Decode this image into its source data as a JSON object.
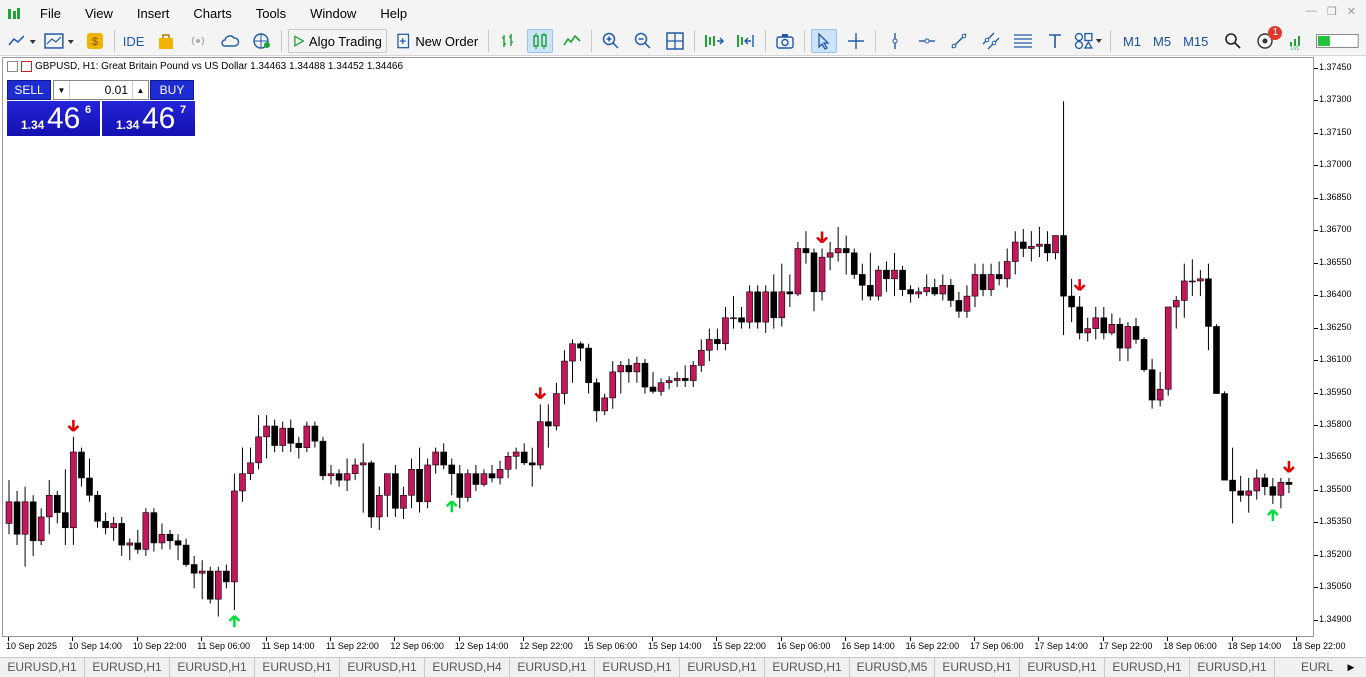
{
  "menu": [
    "File",
    "Edit",
    "View",
    "Insert",
    "Charts",
    "Tools",
    "Window",
    "Help"
  ],
  "toolbar": {
    "ide_label": "IDE",
    "algo_label": "Algo Trading",
    "neworder_label": "New Order",
    "timeframes": [
      "M1",
      "M5",
      "M15"
    ],
    "notification_count": "1"
  },
  "chart": {
    "symbol_line": "GBPUSD, H1:  Great Britain Pound vs US Dollar  1.34463 1.34488 1.34452 1.34466",
    "sell_label": "SELL",
    "buy_label": "BUY",
    "volume": "0.01",
    "sell_prefix": "1.34",
    "sell_big": "46",
    "sell_sup": "6",
    "buy_prefix": "1.34",
    "buy_big": "46",
    "buy_sup": "7",
    "up_color": "#c2185b",
    "down_color": "#000000",
    "arrow_up_color": "#00e03a",
    "arrow_down_color": "#e00000"
  },
  "price_labels": [
    "1.37450",
    "1.37300",
    "1.37150",
    "1.37000",
    "1.36850",
    "1.36700",
    "1.36550",
    "1.36400",
    "1.36250",
    "1.36100",
    "1.35950",
    "1.35800",
    "1.35650",
    "1.35500",
    "1.35350",
    "1.35200",
    "1.35050",
    "1.34900"
  ],
  "time_labels": [
    "10 Sep 2025",
    "10 Sep 14:00",
    "10 Sep 22:00",
    "11 Sep 06:00",
    "11 Sep 14:00",
    "11 Sep 22:00",
    "12 Sep 06:00",
    "12 Sep 14:00",
    "12 Sep 22:00",
    "15 Sep 06:00",
    "15 Sep 14:00",
    "15 Sep 22:00",
    "16 Sep 06:00",
    "16 Sep 14:00",
    "16 Sep 22:00",
    "17 Sep 06:00",
    "17 Sep 14:00",
    "17 Sep 22:00",
    "18 Sep 06:00",
    "18 Sep 14:00",
    "18 Sep 22:00"
  ],
  "tabs": [
    "EURUSD,H1",
    "EURUSD,H1",
    "EURUSD,H1",
    "EURUSD,H1",
    "EURUSD,H1",
    "EURUSD,H4",
    "EURUSD,H1",
    "EURUSD,H1",
    "EURUSD,H1",
    "EURUSD,H1",
    "EURUSD,M5",
    "EURUSD,H1",
    "EURUSD,H1",
    "EURUSD,H1",
    "EURUSD,H1",
    "EURL"
  ],
  "chart_data": {
    "type": "candlestick",
    "symbol": "GBPUSD",
    "timeframe": "H1",
    "ylim": [
      1.3483,
      1.375
    ],
    "candles": [
      [
        1.3535,
        1.3555,
        1.353,
        1.3545
      ],
      [
        1.3545,
        1.355,
        1.3525,
        1.353
      ],
      [
        1.353,
        1.3552,
        1.3515,
        1.3545
      ],
      [
        1.3545,
        1.3548,
        1.352,
        1.3527
      ],
      [
        1.3527,
        1.3542,
        1.3525,
        1.3538
      ],
      [
        1.3538,
        1.3555,
        1.353,
        1.3548
      ],
      [
        1.3548,
        1.355,
        1.3535,
        1.354
      ],
      [
        1.354,
        1.356,
        1.3525,
        1.3533
      ],
      [
        1.3533,
        1.3575,
        1.3525,
        1.3568
      ],
      [
        1.3568,
        1.357,
        1.3552,
        1.3556
      ],
      [
        1.3556,
        1.3565,
        1.3545,
        1.3548
      ],
      [
        1.3548,
        1.355,
        1.3533,
        1.3536
      ],
      [
        1.3536,
        1.354,
        1.353,
        1.3533
      ],
      [
        1.3533,
        1.3538,
        1.3527,
        1.3535
      ],
      [
        1.3535,
        1.3538,
        1.352,
        1.3525
      ],
      [
        1.3525,
        1.3528,
        1.3518,
        1.3526
      ],
      [
        1.3526,
        1.3532,
        1.3521,
        1.3523
      ],
      [
        1.3523,
        1.3542,
        1.352,
        1.354
      ],
      [
        1.354,
        1.3542,
        1.3522,
        1.3526
      ],
      [
        1.3526,
        1.3535,
        1.3523,
        1.353
      ],
      [
        1.353,
        1.3532,
        1.3523,
        1.3527
      ],
      [
        1.3527,
        1.353,
        1.3518,
        1.3525
      ],
      [
        1.3525,
        1.3528,
        1.3515,
        1.3516
      ],
      [
        1.3516,
        1.352,
        1.3505,
        1.3512
      ],
      [
        1.3512,
        1.3518,
        1.35,
        1.3513
      ],
      [
        1.3513,
        1.3515,
        1.3498,
        1.35
      ],
      [
        1.35,
        1.3515,
        1.3492,
        1.3513
      ],
      [
        1.3513,
        1.3516,
        1.3505,
        1.3508
      ],
      [
        1.3508,
        1.3558,
        1.3495,
        1.355
      ],
      [
        1.355,
        1.357,
        1.3545,
        1.3558
      ],
      [
        1.3558,
        1.357,
        1.3555,
        1.3563
      ],
      [
        1.3563,
        1.3585,
        1.356,
        1.3575
      ],
      [
        1.3575,
        1.3585,
        1.3565,
        1.358
      ],
      [
        1.358,
        1.3583,
        1.3568,
        1.3571
      ],
      [
        1.3571,
        1.3582,
        1.3568,
        1.3579
      ],
      [
        1.3579,
        1.3583,
        1.3568,
        1.3572
      ],
      [
        1.3572,
        1.3575,
        1.3565,
        1.357
      ],
      [
        1.357,
        1.3582,
        1.3568,
        1.358
      ],
      [
        1.358,
        1.3582,
        1.357,
        1.3573
      ],
      [
        1.3573,
        1.3575,
        1.3555,
        1.3557
      ],
      [
        1.3557,
        1.3562,
        1.3553,
        1.3558
      ],
      [
        1.3558,
        1.356,
        1.3552,
        1.3555
      ],
      [
        1.3555,
        1.3565,
        1.355,
        1.3558
      ],
      [
        1.3558,
        1.3565,
        1.3555,
        1.3562
      ],
      [
        1.3562,
        1.3572,
        1.354,
        1.3563
      ],
      [
        1.3563,
        1.3564,
        1.3533,
        1.3538
      ],
      [
        1.3538,
        1.3552,
        1.3532,
        1.3548
      ],
      [
        1.3548,
        1.3557,
        1.3538,
        1.3558
      ],
      [
        1.3558,
        1.3562,
        1.3538,
        1.3542
      ],
      [
        1.3542,
        1.3552,
        1.3537,
        1.3548
      ],
      [
        1.3548,
        1.3565,
        1.3542,
        1.356
      ],
      [
        1.356,
        1.357,
        1.354,
        1.3545
      ],
      [
        1.3545,
        1.3565,
        1.3542,
        1.3562
      ],
      [
        1.3562,
        1.357,
        1.3558,
        1.3568
      ],
      [
        1.3568,
        1.3572,
        1.356,
        1.3562
      ],
      [
        1.3562,
        1.3565,
        1.3548,
        1.3558
      ],
      [
        1.3558,
        1.3562,
        1.3542,
        1.3547
      ],
      [
        1.3547,
        1.356,
        1.3545,
        1.3558
      ],
      [
        1.3558,
        1.3562,
        1.355,
        1.3553
      ],
      [
        1.3553,
        1.356,
        1.3552,
        1.3558
      ],
      [
        1.3558,
        1.3562,
        1.3554,
        1.3556
      ],
      [
        1.3556,
        1.3564,
        1.3553,
        1.356
      ],
      [
        1.356,
        1.3568,
        1.3556,
        1.3566
      ],
      [
        1.3566,
        1.357,
        1.356,
        1.3568
      ],
      [
        1.3568,
        1.3572,
        1.3562,
        1.3563
      ],
      [
        1.3563,
        1.357,
        1.3552,
        1.3562
      ],
      [
        1.3562,
        1.359,
        1.356,
        1.3582
      ],
      [
        1.3582,
        1.359,
        1.357,
        1.358
      ],
      [
        1.358,
        1.36,
        1.3578,
        1.3595
      ],
      [
        1.3595,
        1.3615,
        1.359,
        1.361
      ],
      [
        1.361,
        1.362,
        1.36,
        1.3618
      ],
      [
        1.3618,
        1.3619,
        1.361,
        1.3616
      ],
      [
        1.3616,
        1.3618,
        1.3595,
        1.36
      ],
      [
        1.36,
        1.3602,
        1.3582,
        1.3587
      ],
      [
        1.3587,
        1.3595,
        1.3585,
        1.3593
      ],
      [
        1.3593,
        1.361,
        1.3588,
        1.3605
      ],
      [
        1.3605,
        1.361,
        1.3595,
        1.3608
      ],
      [
        1.3608,
        1.3611,
        1.36,
        1.3605
      ],
      [
        1.3605,
        1.3612,
        1.36,
        1.3609
      ],
      [
        1.3609,
        1.3611,
        1.3595,
        1.3598
      ],
      [
        1.3598,
        1.3605,
        1.3595,
        1.3596
      ],
      [
        1.3596,
        1.3602,
        1.3594,
        1.36
      ],
      [
        1.36,
        1.3603,
        1.3597,
        1.3601
      ],
      [
        1.3601,
        1.3605,
        1.3598,
        1.3602
      ],
      [
        1.3602,
        1.3608,
        1.3598,
        1.3601
      ],
      [
        1.3601,
        1.361,
        1.3598,
        1.3608
      ],
      [
        1.3608,
        1.362,
        1.3605,
        1.3615
      ],
      [
        1.3615,
        1.3625,
        1.361,
        1.362
      ],
      [
        1.362,
        1.3625,
        1.3615,
        1.3618
      ],
      [
        1.3618,
        1.3635,
        1.3615,
        1.363
      ],
      [
        1.363,
        1.364,
        1.3625,
        1.363
      ],
      [
        1.363,
        1.3635,
        1.3625,
        1.3628
      ],
      [
        1.3628,
        1.3645,
        1.3625,
        1.3642
      ],
      [
        1.3642,
        1.3645,
        1.3625,
        1.3628
      ],
      [
        1.3628,
        1.3645,
        1.3623,
        1.3642
      ],
      [
        1.3642,
        1.365,
        1.3625,
        1.363
      ],
      [
        1.363,
        1.3655,
        1.3626,
        1.3642
      ],
      [
        1.3642,
        1.365,
        1.3635,
        1.3641
      ],
      [
        1.3641,
        1.3665,
        1.364,
        1.3662
      ],
      [
        1.3662,
        1.367,
        1.3655,
        1.366
      ],
      [
        1.366,
        1.3662,
        1.3633,
        1.3642
      ],
      [
        1.3642,
        1.3662,
        1.3638,
        1.3658
      ],
      [
        1.3658,
        1.3665,
        1.3652,
        1.366
      ],
      [
        1.366,
        1.3672,
        1.3656,
        1.3662
      ],
      [
        1.3662,
        1.3668,
        1.365,
        1.366
      ],
      [
        1.366,
        1.3662,
        1.3648,
        1.365
      ],
      [
        1.365,
        1.3655,
        1.3638,
        1.3645
      ],
      [
        1.3645,
        1.366,
        1.3638,
        1.364
      ],
      [
        1.364,
        1.3654,
        1.3638,
        1.3652
      ],
      [
        1.3652,
        1.3656,
        1.3642,
        1.3648
      ],
      [
        1.3648,
        1.366,
        1.364,
        1.3652
      ],
      [
        1.3652,
        1.3654,
        1.364,
        1.3643
      ],
      [
        1.3643,
        1.3645,
        1.3637,
        1.3641
      ],
      [
        1.3641,
        1.3644,
        1.3639,
        1.3642
      ],
      [
        1.3642,
        1.365,
        1.364,
        1.3644
      ],
      [
        1.3644,
        1.3648,
        1.364,
        1.3641
      ],
      [
        1.3641,
        1.365,
        1.3638,
        1.3645
      ],
      [
        1.3645,
        1.3648,
        1.3635,
        1.3638
      ],
      [
        1.3638,
        1.3642,
        1.363,
        1.3633
      ],
      [
        1.3633,
        1.3645,
        1.363,
        1.364
      ],
      [
        1.364,
        1.3655,
        1.3635,
        1.365
      ],
      [
        1.365,
        1.3655,
        1.364,
        1.3643
      ],
      [
        1.3643,
        1.3655,
        1.364,
        1.365
      ],
      [
        1.365,
        1.3656,
        1.3645,
        1.3648
      ],
      [
        1.3648,
        1.3662,
        1.3644,
        1.3656
      ],
      [
        1.3656,
        1.367,
        1.365,
        1.3665
      ],
      [
        1.3665,
        1.3671,
        1.3658,
        1.3662
      ],
      [
        1.3662,
        1.367,
        1.3656,
        1.3663
      ],
      [
        1.3663,
        1.3672,
        1.3658,
        1.3664
      ],
      [
        1.3664,
        1.367,
        1.3656,
        1.366
      ],
      [
        1.366,
        1.3668,
        1.3657,
        1.3668
      ],
      [
        1.3668,
        1.373,
        1.3622,
        1.364
      ],
      [
        1.364,
        1.3648,
        1.3628,
        1.3635
      ],
      [
        1.3635,
        1.364,
        1.362,
        1.3623
      ],
      [
        1.3623,
        1.363,
        1.3619,
        1.3625
      ],
      [
        1.3625,
        1.3635,
        1.362,
        1.363
      ],
      [
        1.363,
        1.3635,
        1.362,
        1.3623
      ],
      [
        1.3623,
        1.3632,
        1.3622,
        1.3627
      ],
      [
        1.3627,
        1.363,
        1.361,
        1.3616
      ],
      [
        1.3616,
        1.3628,
        1.361,
        1.3626
      ],
      [
        1.3626,
        1.363,
        1.3618,
        1.362
      ],
      [
        1.362,
        1.3621,
        1.3605,
        1.3606
      ],
      [
        1.3606,
        1.3611,
        1.3588,
        1.3592
      ],
      [
        1.3592,
        1.3605,
        1.3589,
        1.3597
      ],
      [
        1.3597,
        1.3632,
        1.3594,
        1.3635
      ],
      [
        1.3635,
        1.364,
        1.3625,
        1.3638
      ],
      [
        1.3638,
        1.3655,
        1.363,
        1.3647
      ],
      [
        1.3647,
        1.3657,
        1.364,
        1.3647
      ],
      [
        1.3647,
        1.3652,
        1.364,
        1.3648
      ],
      [
        1.3648,
        1.3655,
        1.3615,
        1.3626
      ],
      [
        1.3626,
        1.3627,
        1.3595,
        1.3595
      ],
      [
        1.3595,
        1.3596,
        1.3555,
        1.3555
      ],
      [
        1.3555,
        1.357,
        1.3535,
        1.355
      ],
      [
        1.355,
        1.3557,
        1.3545,
        1.3548
      ],
      [
        1.3548,
        1.3556,
        1.354,
        1.355
      ],
      [
        1.355,
        1.356,
        1.3546,
        1.3556
      ],
      [
        1.3556,
        1.3558,
        1.3548,
        1.3552
      ],
      [
        1.3552,
        1.3556,
        1.3544,
        1.3548
      ],
      [
        1.3548,
        1.3556,
        1.3542,
        1.3554
      ],
      [
        1.3554,
        1.3556,
        1.3549,
        1.3553
      ]
    ],
    "signals_down": [
      8,
      66,
      101,
      133,
      159
    ],
    "signals_up": [
      28,
      55,
      157
    ]
  }
}
